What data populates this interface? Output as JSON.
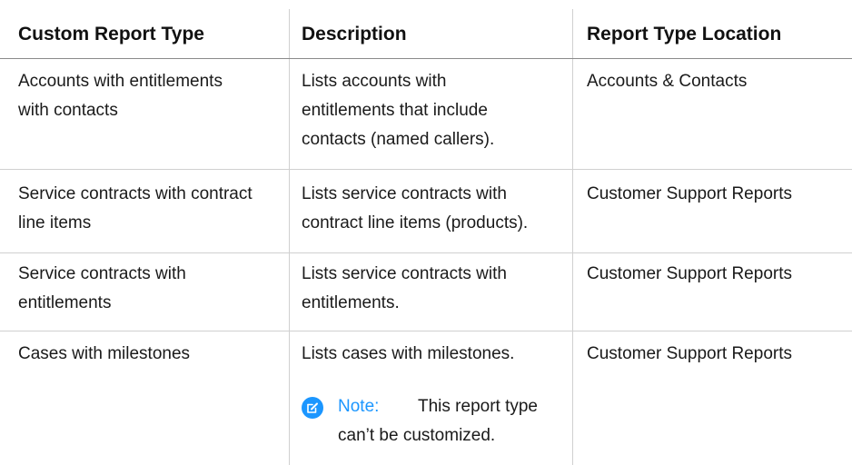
{
  "table": {
    "headers": [
      "Custom Report Type",
      "Description",
      "Report Type Location"
    ],
    "rows": [
      {
        "type_lines": [
          "Accounts with entitlements",
          "with contacts"
        ],
        "desc_lines": [
          "Lists accounts with",
          "entitlements that include",
          "contacts (named callers)."
        ],
        "location": "Accounts & Contacts"
      },
      {
        "type_lines": [
          "Service contracts with contract",
          "line items"
        ],
        "desc_lines": [
          "Lists service contracts with",
          "contract line items (products)."
        ],
        "location": "Customer Support Reports"
      },
      {
        "type_lines": [
          "Service contracts with",
          "entitlements"
        ],
        "desc_lines": [
          "Lists service contracts with",
          "entitlements."
        ],
        "location": "Customer Support Reports"
      },
      {
        "type_lines": [
          "Cases with milestones"
        ],
        "desc_lines": [
          "Lists cases with milestones."
        ],
        "location": "Customer Support Reports"
      }
    ],
    "note": {
      "label": "Note:",
      "text_line1": "This report type",
      "text_line2": "can’t be customized.",
      "icon": "note-edit-icon",
      "accent_color": "#1b96ff"
    }
  }
}
